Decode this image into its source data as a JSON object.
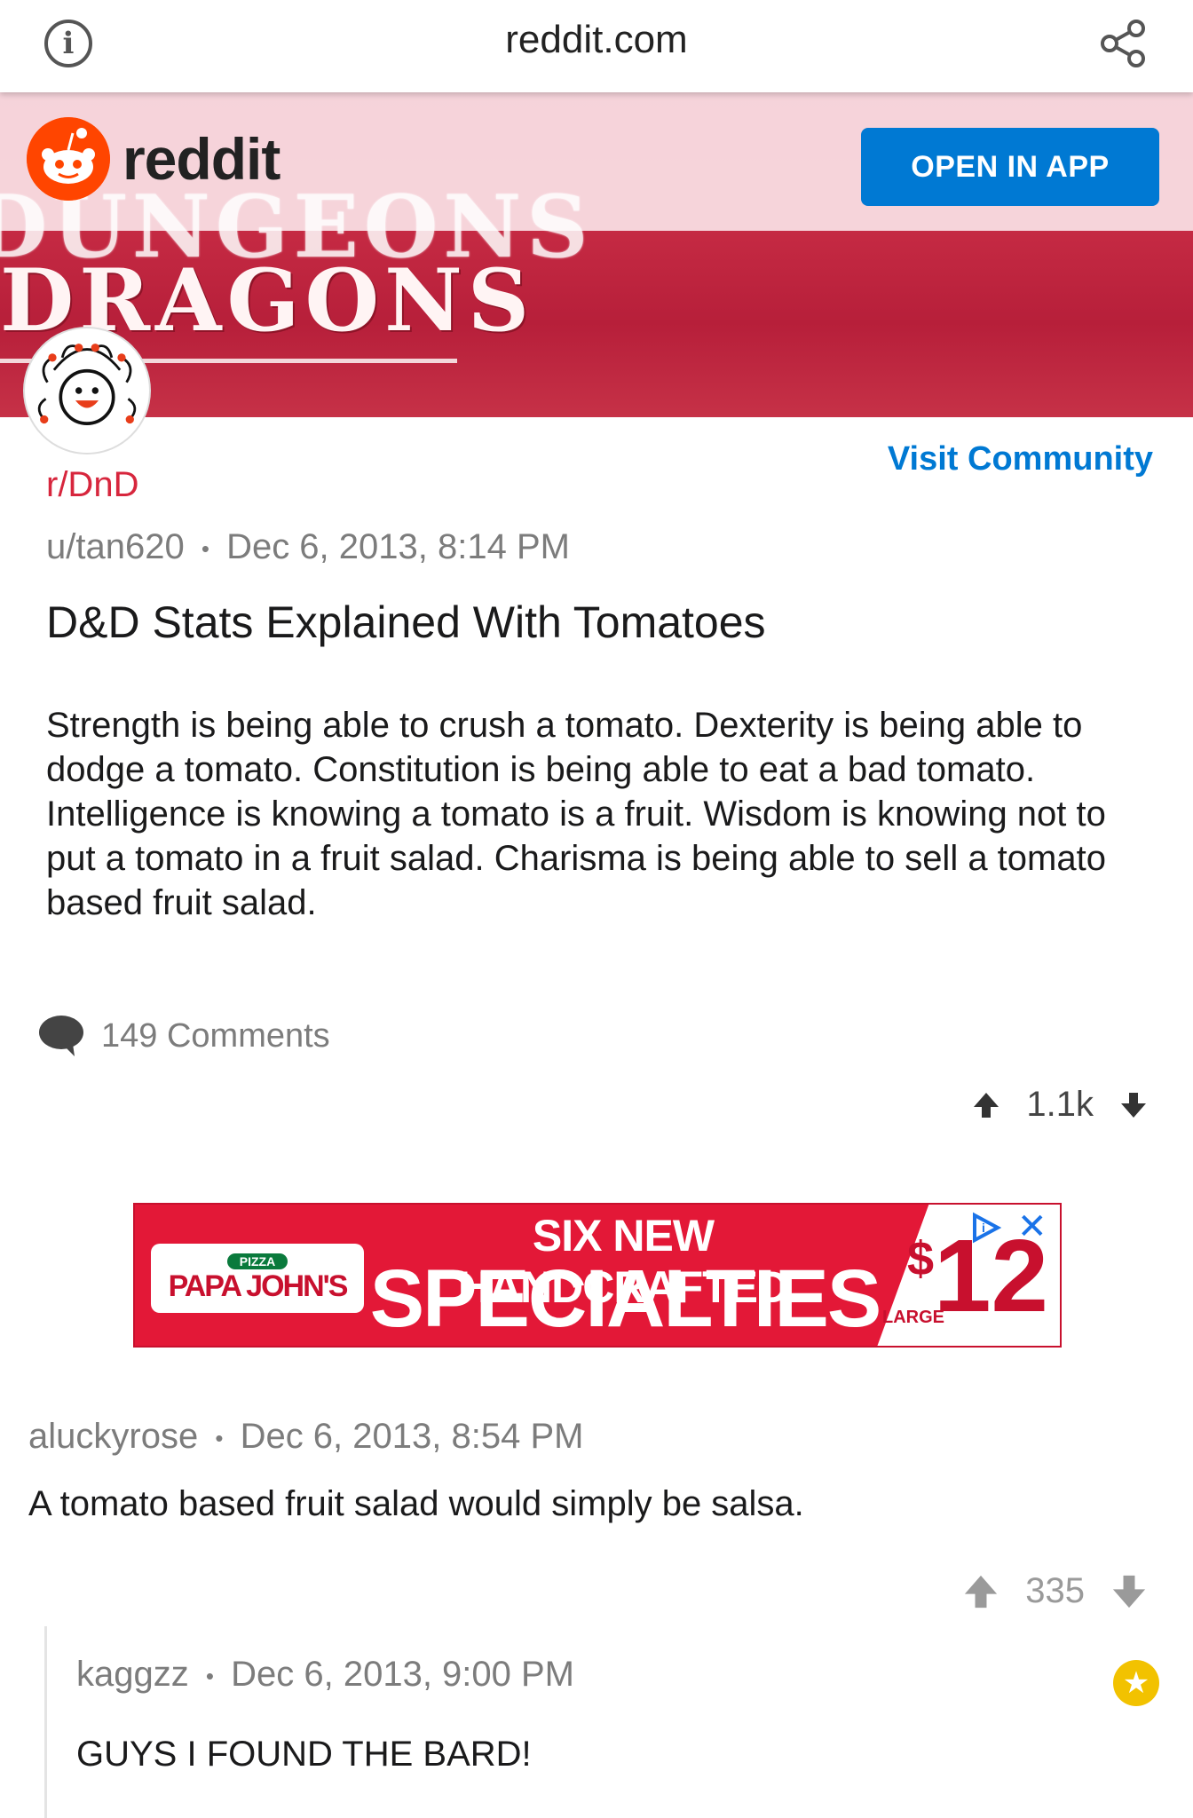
{
  "browser": {
    "url": "reddit.com",
    "info_icon": "info-icon",
    "share_icon": "share-icon"
  },
  "header": {
    "brand": "reddit",
    "brand_color": "#ff4500",
    "open_app_label": "OPEN IN APP",
    "open_app_color": "#0079d3"
  },
  "banner": {
    "line1": "DUNGEONS",
    "line2": "DRAGONS"
  },
  "post": {
    "visit_label": "Visit Community",
    "subreddit": "r/DnD",
    "author": "u/tan620",
    "separator": "•",
    "timestamp": "Dec 6, 2013, 8:14 PM",
    "title": "D&D Stats Explained With Tomatoes",
    "body": "Strength is being able to crush a tomato. Dexterity is being able to dodge a tomato. Constitution is being able to eat a bad tomato. Intelligence is knowing a tomato is a fruit. Wisdom is knowing not to put a tomato in a fruit salad. Charisma is being able to sell a tomato based fruit salad.",
    "comments_label": "149 Comments",
    "score": "1.1k"
  },
  "ad": {
    "logo_small": "PIZZA",
    "logo": "PAPA JOHN'S",
    "line1": "SIX NEW HANDCRAFTED",
    "line2": "SPECIALTIES",
    "price_currency": "$",
    "price_value": "12",
    "size": "LARGE",
    "close": "✕",
    "accent_color": "#e31837"
  },
  "comments": [
    {
      "author": "aluckyrose",
      "separator": "•",
      "timestamp": "Dec 6, 2013, 8:54 PM",
      "body": "A tomato based fruit salad would simply be salsa.",
      "score": "335"
    },
    {
      "author": "kaggzz",
      "separator": "•",
      "timestamp": "Dec 6, 2013, 9:00 PM",
      "body": "GUYS I FOUND THE BARD!",
      "award_icon": "star-award-icon"
    }
  ]
}
